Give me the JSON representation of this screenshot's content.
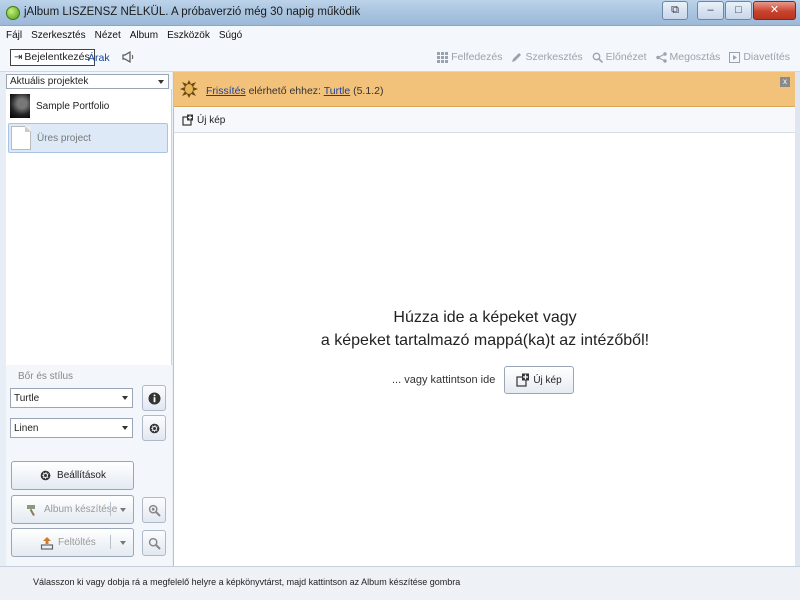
{
  "window": {
    "title": "jAlbum LISZENSZ NÉLKÜL. A próbaverzió még 30 napig működik",
    "btn_extra": "⧉",
    "btn_minimize": "–",
    "btn_maximize": "□",
    "btn_close": "✕"
  },
  "menu": [
    "Fájl",
    "Szerkesztés",
    "Nézet",
    "Album",
    "Eszközök",
    "Súgó"
  ],
  "toolbar": {
    "login_label": "Bejelentkezés",
    "prices_label": "Árak",
    "right_items": [
      {
        "label": "Felfedezés",
        "icon": "grid-icon"
      },
      {
        "label": "Szerkesztés",
        "icon": "pencil-icon"
      },
      {
        "label": "Előnézet",
        "icon": "magnifier-icon"
      },
      {
        "label": "Megosztás",
        "icon": "share-icon"
      },
      {
        "label": "Diavetítés",
        "icon": "play-icon"
      }
    ]
  },
  "left": {
    "projects_combo": "Aktuális projektek",
    "projects": [
      {
        "label": "Sample Portfolio",
        "thumb": "photo"
      },
      {
        "label": "Üres project",
        "thumb": "document"
      }
    ],
    "skin_section_label": "Bőr és stílus",
    "skin_value": "Turtle",
    "style_value": "Linen",
    "settings_label": "Beállítások",
    "make_album_label": "Album készítése",
    "upload_label": "Feltöltés"
  },
  "banner": {
    "link1": "Frissítés",
    "text_mid": " elérhető ehhez: ",
    "link2": "Turtle",
    "version": " (5.1.2)",
    "close": "x"
  },
  "main": {
    "new_image_label": "Új kép",
    "drop_line1": "Húzza ide a képeket vagy",
    "drop_line2": "a képeket tartalmazó mappá(ka)t az intézőből!",
    "drop_alt": "... vagy kattintson ide",
    "drop_button_label": "Új kép"
  },
  "status": {
    "text": "Válasszon ki vagy dobja rá a megfelelő helyre a képkönyvtárst, majd kattintson az Album készítése gombra"
  }
}
